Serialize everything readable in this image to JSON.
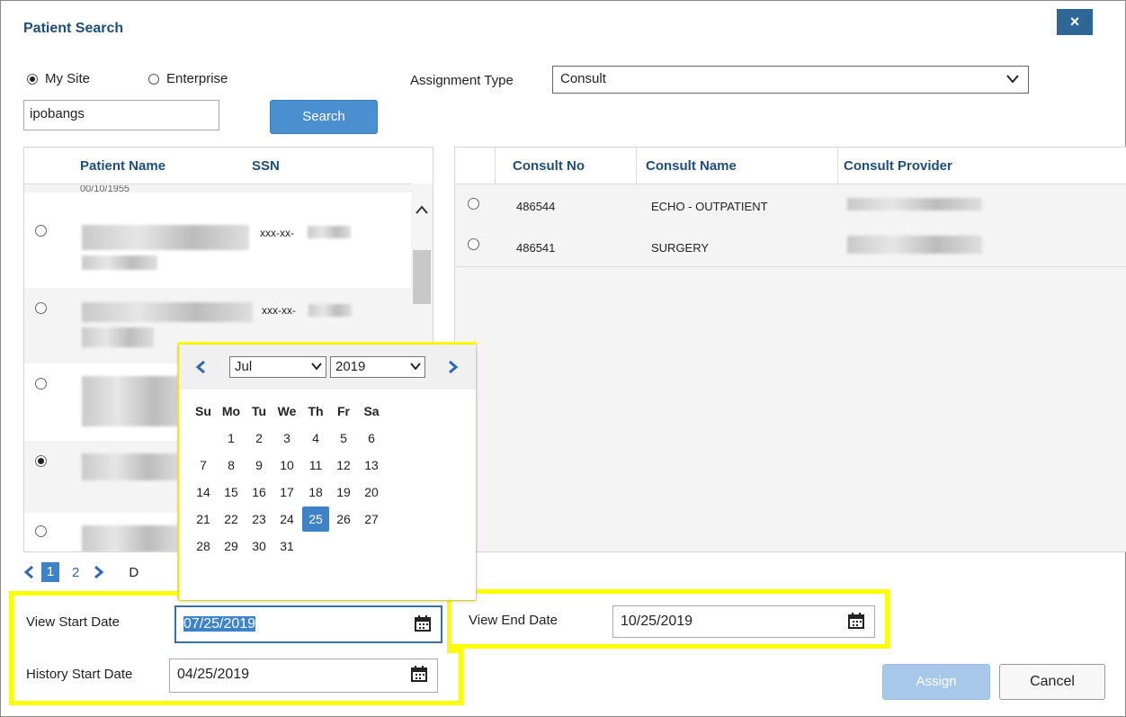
{
  "dialog": {
    "title": "Patient Search",
    "close_label": "×"
  },
  "search": {
    "site_options": [
      {
        "label": "My Site",
        "checked": true
      },
      {
        "label": "Enterprise",
        "checked": false
      }
    ],
    "query": "ipobangs",
    "search_label": "Search",
    "assignment_type_label": "Assignment Type",
    "assignment_type_value": "Consult"
  },
  "patients": {
    "columns": [
      "Patient Name",
      "SSN"
    ],
    "partial_text": "00/10/1955",
    "rows": [
      {
        "ssn": "xxx-xx-",
        "selected": false
      },
      {
        "ssn": "xxx-xx-",
        "selected": false
      },
      {
        "ssn": "",
        "selected": false
      },
      {
        "ssn": "",
        "selected": true
      },
      {
        "ssn": "",
        "selected": false
      }
    ],
    "pager": {
      "current": "1",
      "next_page": "2",
      "truncated_label": "D"
    }
  },
  "consults": {
    "columns": [
      "Consult No",
      "Consult Name",
      "Consult Provider"
    ],
    "rows": [
      {
        "no": "486544",
        "name": "ECHO - OUTPATIENT"
      },
      {
        "no": "486541",
        "name": "SURGERY"
      }
    ]
  },
  "calendar": {
    "month": "Jul",
    "year": "2019",
    "weekdays": [
      "Su",
      "Mo",
      "Tu",
      "We",
      "Th",
      "Fr",
      "Sa"
    ],
    "first_weekday": 1,
    "days_in_month": 31,
    "selected_day": 25,
    "highlight_color": "#ffff00",
    "accent_color": "#3e83c8"
  },
  "dates": {
    "view_start_label": "View Start Date",
    "view_start_value": "07/25/2019",
    "view_end_label": "View End Date",
    "view_end_value": "10/25/2019",
    "history_start_label": "History Start Date",
    "history_start_value": "04/25/2019"
  },
  "actions": {
    "assign": "Assign",
    "cancel": "Cancel"
  }
}
